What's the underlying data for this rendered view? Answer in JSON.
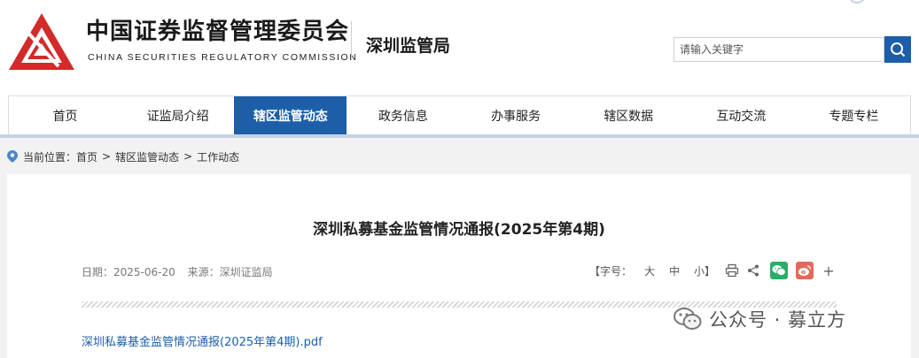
{
  "header": {
    "org_name_cn": "中国证券监督管理委员会",
    "org_name_en": "CHINA SECURITIES REGULATORY COMMISSION",
    "bureau": "深圳监管局",
    "search": {
      "placeholder": "请输入关键字"
    },
    "colors": {
      "brand_red": "#d32a2a",
      "brand_blue": "#1c5fa8"
    }
  },
  "nav": {
    "items": [
      {
        "label": "首页"
      },
      {
        "label": "证监局介绍"
      },
      {
        "label": "辖区监管动态",
        "active": true
      },
      {
        "label": "政务信息"
      },
      {
        "label": "办事服务"
      },
      {
        "label": "辖区数据"
      },
      {
        "label": "互动交流"
      },
      {
        "label": "专题专栏"
      }
    ]
  },
  "breadcrumb": {
    "prefix": "当前位置：",
    "items": [
      "首页",
      "辖区监管动态",
      "工作动态"
    ],
    "separator": ">"
  },
  "article": {
    "title": "深圳私募基金监管情况通报(2025年第4期)",
    "date": "日期：2025-06-20",
    "source": "来源：深圳证监局",
    "font_size_label": "【字号：",
    "font_sizes": [
      "大",
      "中",
      "小】"
    ],
    "attachment": "深圳私募基金监管情况通报(2025年第4期).pdf"
  },
  "watermark": {
    "text": "公众号 · 募立方",
    "icon": "wechat-icon"
  }
}
